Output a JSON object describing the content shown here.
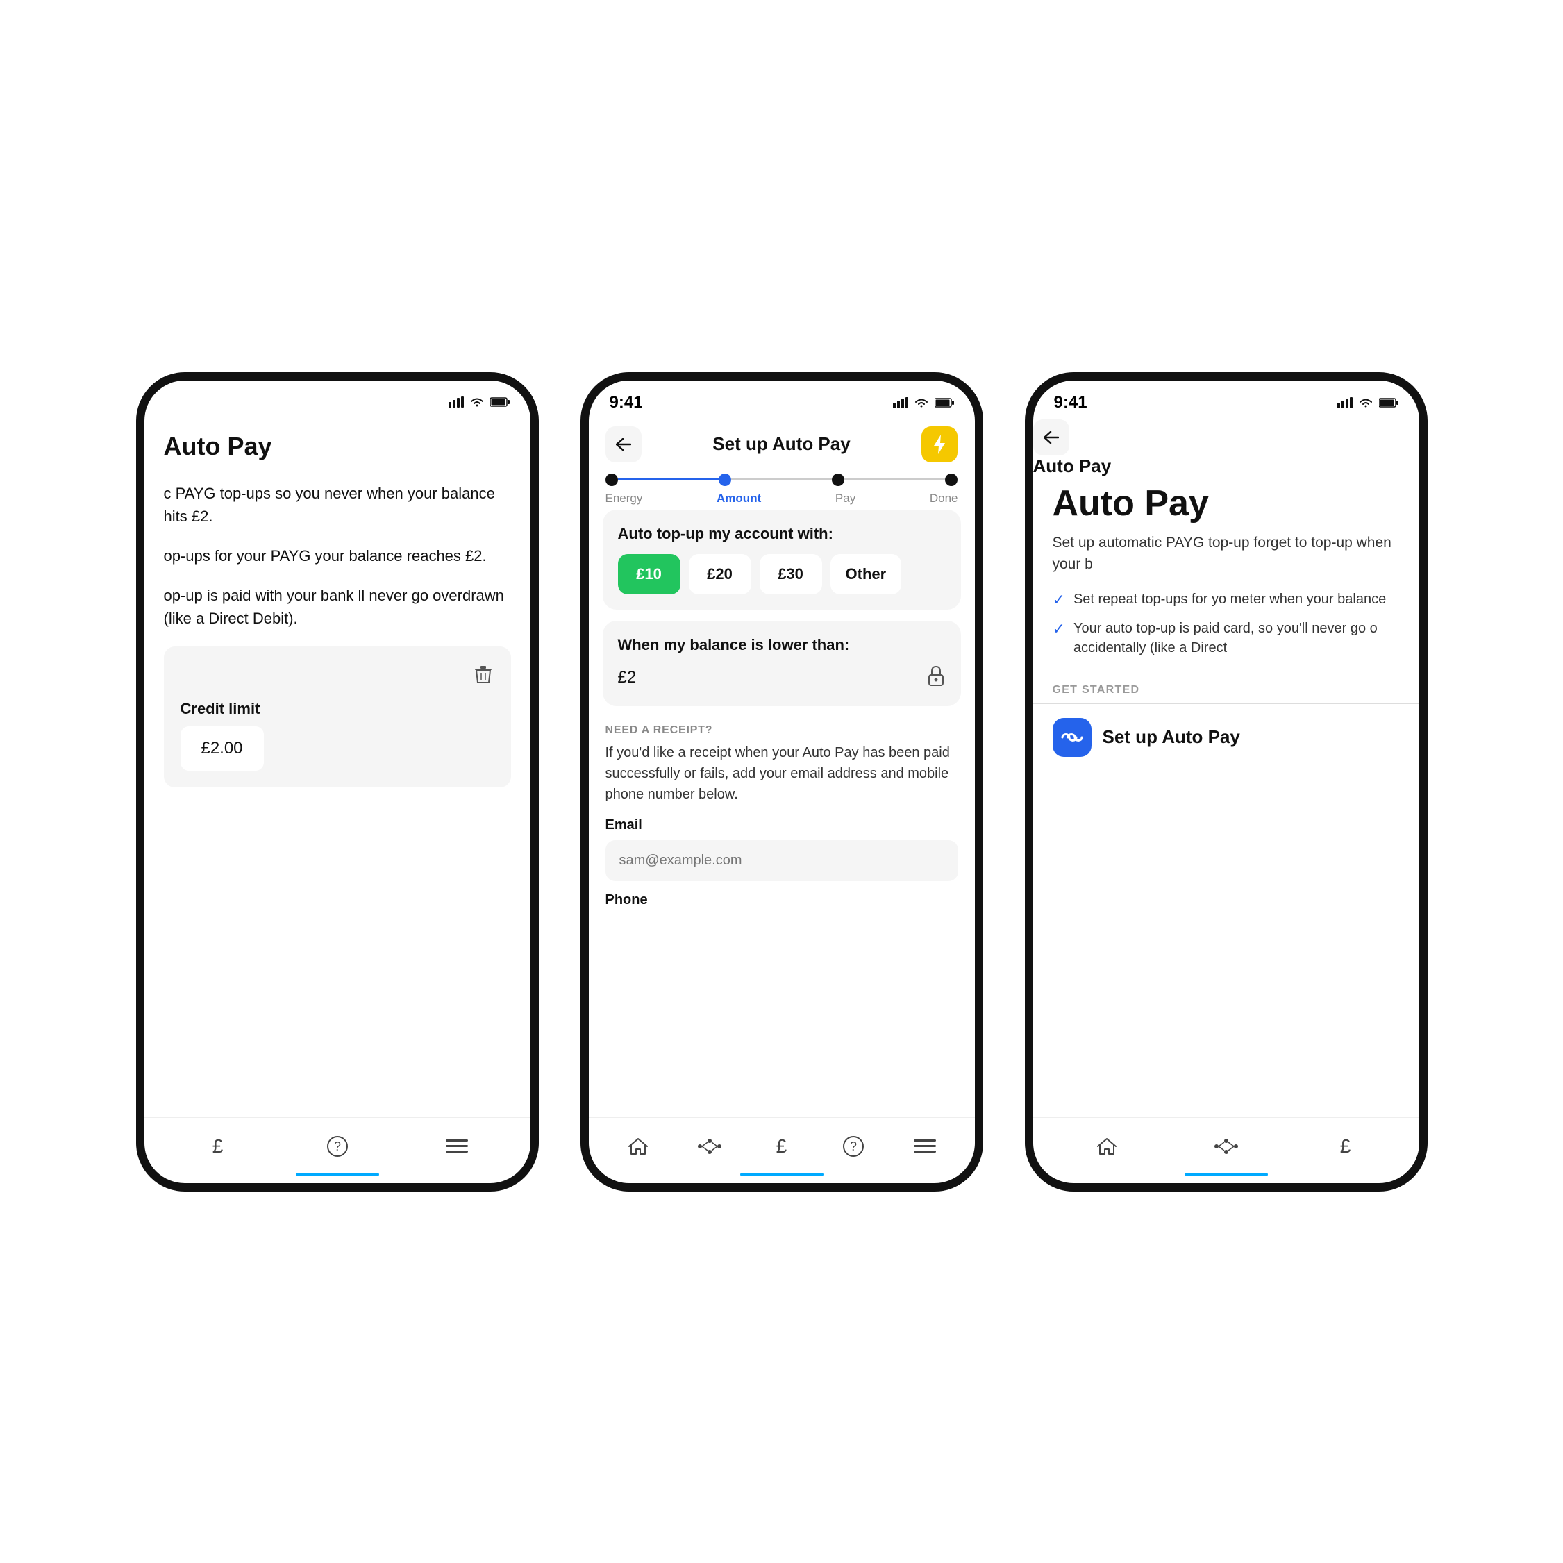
{
  "phone_left": {
    "title": "Auto Pay",
    "body_text_1": "c PAYG top-ups so you never when your balance hits £2.",
    "body_text_2": "op-ups for your PAYG your balance reaches £2.",
    "body_text_3": "op-up is paid with your bank ll never go overdrawn (like a Direct Debit).",
    "credit_section": {
      "label": "Credit limit",
      "value": "£2.00"
    },
    "nav_icons": [
      "£",
      "?",
      "≡"
    ]
  },
  "phone_center": {
    "status_time": "9:41",
    "header": {
      "title": "Set up Auto Pay",
      "back_label": "←",
      "lightning_icon": "⚡"
    },
    "stepper": {
      "steps": [
        {
          "label": "Energy",
          "state": "filled"
        },
        {
          "label": "Amount",
          "state": "active"
        },
        {
          "label": "Pay",
          "state": "inactive"
        },
        {
          "label": "Done",
          "state": "inactive"
        }
      ]
    },
    "amount_card": {
      "title": "Auto top-up my account with:",
      "options": [
        {
          "value": "£10",
          "selected": true
        },
        {
          "value": "£20",
          "selected": false
        },
        {
          "value": "£30",
          "selected": false
        },
        {
          "value": "Other",
          "selected": false
        }
      ]
    },
    "balance_card": {
      "title": "When my balance is lower than:",
      "value": "£2",
      "lock_icon": "🔒"
    },
    "receipt_section": {
      "label": "NEED A RECEIPT?",
      "text": "If you'd like a receipt when your Auto Pay has been paid successfully or fails, add your email address and mobile phone number below.",
      "email_label": "Email",
      "email_placeholder": "sam@example.com",
      "phone_label": "Phone"
    },
    "nav_icons": [
      "home",
      "connections",
      "meter",
      "help",
      "menu"
    ]
  },
  "phone_right": {
    "status_time": "9:41",
    "header": {
      "title": "Auto Pay",
      "back_label": "←"
    },
    "title": "Auto Pay",
    "description": "Set up automatic PAYG top-up forget to top-up when your b",
    "checklist": [
      {
        "text": "Set repeat top-ups for yo meter when your balance"
      },
      {
        "text": "Your auto top-up is paid card, so you'll never go o accidentally (like a Direct"
      }
    ],
    "get_started_label": "GET STARTED",
    "setup_button": {
      "label": "Set up Auto Pay",
      "icon": "∞"
    },
    "nav_icons": [
      "home",
      "connections",
      "meter"
    ]
  },
  "colors": {
    "accent_blue": "#2563eb",
    "accent_green": "#22c55e",
    "accent_yellow": "#f5c800",
    "tab_indicator": "#00aaff",
    "background_card": "#f5f5f5",
    "text_primary": "#111111",
    "text_secondary": "#888888"
  }
}
